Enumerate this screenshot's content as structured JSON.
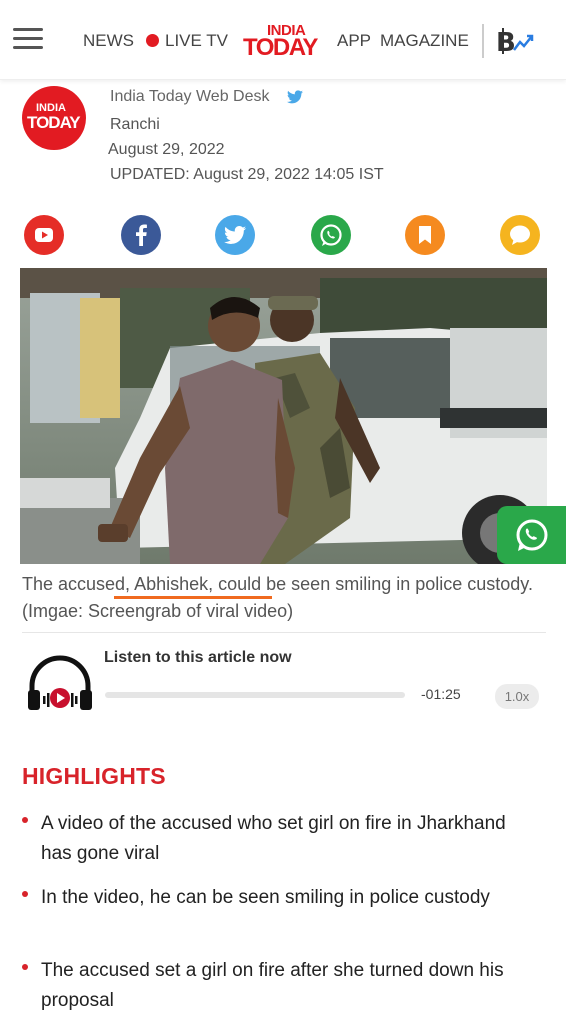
{
  "header": {
    "nav": {
      "news": "NEWS",
      "live_tv": "LIVE TV",
      "app": "APP",
      "magazine": "MAGAZINE"
    },
    "logo": {
      "line1": "INDIA",
      "line2": "TODAY"
    },
    "icons": {
      "menu": "hamburger-menu-icon",
      "live": "live-dot",
      "crypto": "bitcoin-chart-icon"
    }
  },
  "author": {
    "logo": {
      "line1": "INDIA",
      "line2": "TODAY"
    },
    "name": "India Today Web Desk",
    "location": "Ranchi",
    "date": "August 29, 2022",
    "updated": "UPDATED: August 29, 2022 14:05 IST"
  },
  "share": [
    {
      "icon": "youtube-icon",
      "color": "#e52d27"
    },
    {
      "icon": "facebook-icon",
      "color": "#3b5998"
    },
    {
      "icon": "twitter-icon",
      "color": "#4aa8e8"
    },
    {
      "icon": "whatsapp-icon",
      "color": "#2aa84a"
    },
    {
      "icon": "bookmark-icon",
      "color": "#f58a1f"
    },
    {
      "icon": "comment-icon",
      "color": "#f5b41f"
    }
  ],
  "image": {
    "caption": "The accused, Abhishek, could be seen smiling in police custody. (Imgae: Screengrab of viral video)"
  },
  "audio": {
    "label": "Listen to this article now",
    "time_remaining": "-01:25",
    "speed": "1.0x",
    "progress": 0
  },
  "highlights": {
    "title": "HIGHLIGHTS",
    "items": [
      "A video of the accused who set girl on fire in Jharkhand has gone viral",
      "In the video, he can be seen smiling in police custody",
      "The accused set a girl on fire after she turned down his proposal"
    ]
  },
  "colors": {
    "brand_red": "#e21b22",
    "highlight_red": "#d8232a",
    "annotation_orange": "#f06a1f",
    "whatsapp_green": "#2aa84a"
  }
}
